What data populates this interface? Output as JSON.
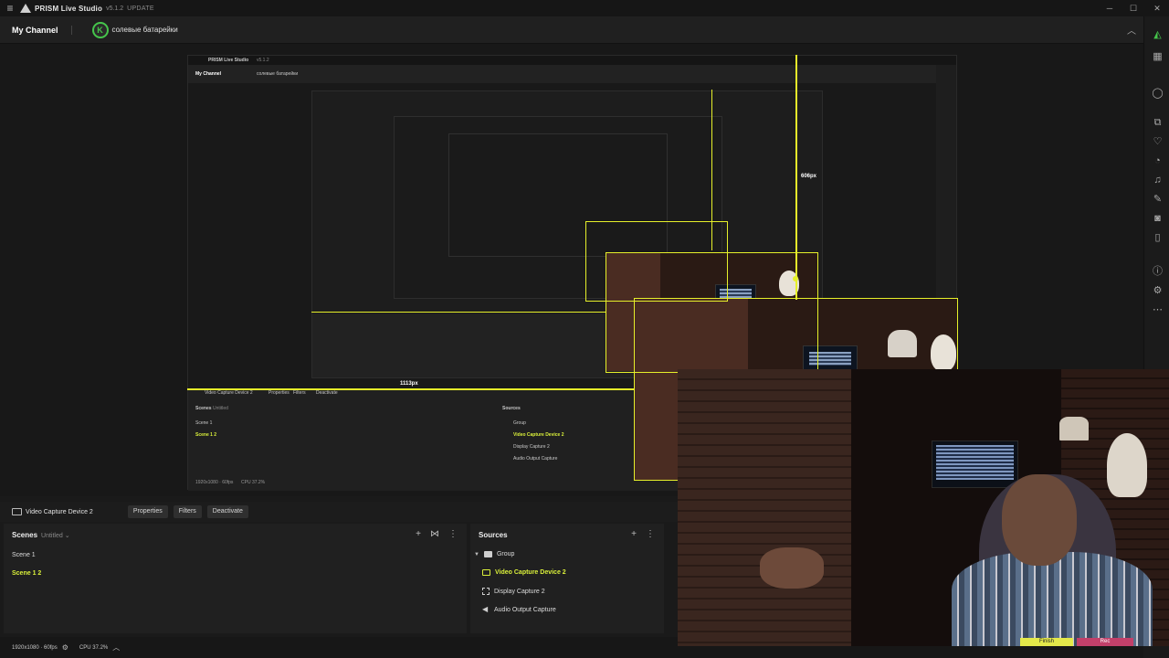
{
  "app": {
    "name": "PRISM Live Studio",
    "version": "v5.1.2",
    "update_label": "UPDATE"
  },
  "channel": {
    "name": "My Channel",
    "user": "солевые батарейки"
  },
  "preview": {
    "measure_horizontal": "1113px",
    "measure_vertical": "606px",
    "nested_source": "Video Capture Device 2",
    "nested_buttons": [
      "Properties",
      "Filters",
      "Deactivate"
    ],
    "nested_scenes_title": "Scenes",
    "nested_scenes_sub": "Untitled",
    "nested_scenes": [
      "Scene 1",
      "Scene 1 2"
    ],
    "nested_sources_title": "Sources",
    "nested_sources": [
      "Group",
      "Video Capture Device 2",
      "Display Capture 2",
      "Audio Output Capture"
    ],
    "nested_status_res": "1920x1080 · 60fps",
    "nested_status_cpu": "CPU 37.2%"
  },
  "source_toolbar": {
    "source_name": "Video Capture Device 2",
    "properties": "Properties",
    "filters": "Filters",
    "deactivate": "Deactivate"
  },
  "scenes": {
    "title": "Scenes",
    "collection": "Untitled",
    "items": [
      "Scene 1",
      "Scene 1 2"
    ],
    "active_index": 1
  },
  "sources": {
    "title": "Sources",
    "items": [
      {
        "label": "Group",
        "icon": "folder-icon"
      },
      {
        "label": "Video Capture Device 2",
        "icon": "video-capture-icon",
        "active": true
      },
      {
        "label": "Display Capture 2",
        "icon": "display-capture-icon"
      },
      {
        "label": "Audio Output Capture",
        "icon": "speaker-icon"
      }
    ]
  },
  "status": {
    "resolution": "1920x1080 · 60fps",
    "cpu": "CPU 37.2%"
  },
  "webcam": {
    "finish_label": "Finish",
    "rec_label": "Rec"
  },
  "colors": {
    "accent": "#d9ef3a",
    "selection": "#e6f02a",
    "brand_green": "#45c54b"
  }
}
